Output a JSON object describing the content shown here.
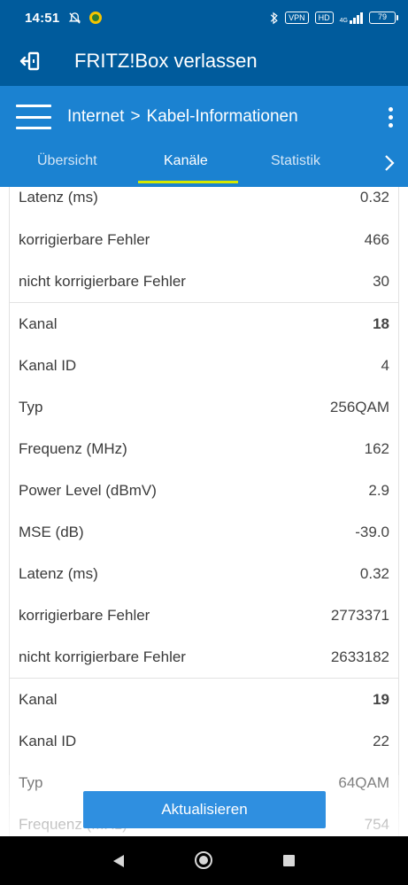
{
  "status_bar": {
    "time": "14:51",
    "vpn_badge": "VPN",
    "volte_badge": "HD",
    "network_type": "4G",
    "battery": "79"
  },
  "exit_bar": {
    "title": "FRITZ!Box verlassen"
  },
  "header": {
    "breadcrumb": {
      "parent": "Internet",
      "separator": ">",
      "current": "Kabel-Informationen"
    }
  },
  "tabs": [
    {
      "label": "Übersicht",
      "active": false
    },
    {
      "label": "Kanäle",
      "active": true
    },
    {
      "label": "Statistik",
      "active": false
    }
  ],
  "channels": {
    "partial_top": [
      {
        "label": "Latenz (ms)",
        "value": "0.32"
      },
      {
        "label": "korrigierbare Fehler",
        "value": "466"
      },
      {
        "label": "nicht korrigierbare Fehler",
        "value": "30"
      }
    ],
    "kanal_18": [
      {
        "label": "Kanal",
        "value": "18"
      },
      {
        "label": "Kanal ID",
        "value": "4"
      },
      {
        "label": "Typ",
        "value": "256QAM"
      },
      {
        "label": "Frequenz (MHz)",
        "value": "162"
      },
      {
        "label": "Power Level (dBmV)",
        "value": "2.9"
      },
      {
        "label": "MSE (dB)",
        "value": "-39.0"
      },
      {
        "label": "Latenz (ms)",
        "value": "0.32"
      },
      {
        "label": "korrigierbare Fehler",
        "value": "2773371"
      },
      {
        "label": "nicht korrigierbare Fehler",
        "value": "2633182"
      }
    ],
    "kanal_19": [
      {
        "label": "Kanal",
        "value": "19"
      },
      {
        "label": "Kanal ID",
        "value": "22"
      },
      {
        "label": "Typ",
        "value": "64QAM"
      },
      {
        "label": "Frequenz (MHz)",
        "value": "754"
      }
    ]
  },
  "refresh_button": {
    "label": "Aktualisieren"
  },
  "colors": {
    "status_bar": "#005b9c",
    "header": "#1b82d1",
    "tab_indicator": "#d4e800",
    "button": "#2f8fe0"
  }
}
